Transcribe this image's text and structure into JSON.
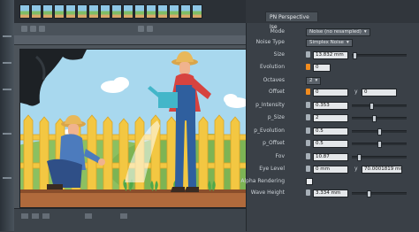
{
  "panel": {
    "title": "PN Perspective Ise",
    "rows": {
      "mode": {
        "label": "Mode",
        "value": "Noise (no resampled)"
      },
      "noise_type": {
        "label": "Noise Type",
        "value": "Simplex Noise"
      },
      "size": {
        "label": "Size",
        "value": "13.832 mm",
        "level": 0.02
      },
      "evolution": {
        "label": "Evolution",
        "value": "0"
      },
      "octaves": {
        "label": "Octaves",
        "value": "2"
      },
      "offset": {
        "label": "Offset",
        "x": "0",
        "y_label": "y",
        "y": "0"
      },
      "p_intensity": {
        "label": "p_Intensity",
        "value": "0.353",
        "level": 0.35
      },
      "p_size": {
        "label": "p_Size",
        "value": "2",
        "level": 0.4
      },
      "p_evolution": {
        "label": "p_Evolution",
        "value": "0.5",
        "level": 0.5
      },
      "p_offset": {
        "label": "p_Offset",
        "value": "0.5",
        "level": 0.5
      },
      "fov": {
        "label": "Fov",
        "value": "10.87",
        "level": 0.1
      },
      "eye_level": {
        "label": "Eye Level",
        "x": "0 mm",
        "y_label": "y",
        "y": "70.0001819 mm"
      },
      "alpha_rendering": {
        "label": "Alpha Rendering"
      },
      "wave_height": {
        "label": "Wave Height",
        "value": "3.334 mm",
        "level": 0.3
      }
    }
  },
  "colors": {
    "panel_bg": "#3a4047",
    "key_active": "#f28c1e",
    "field_bg": "#e4e7ea"
  }
}
